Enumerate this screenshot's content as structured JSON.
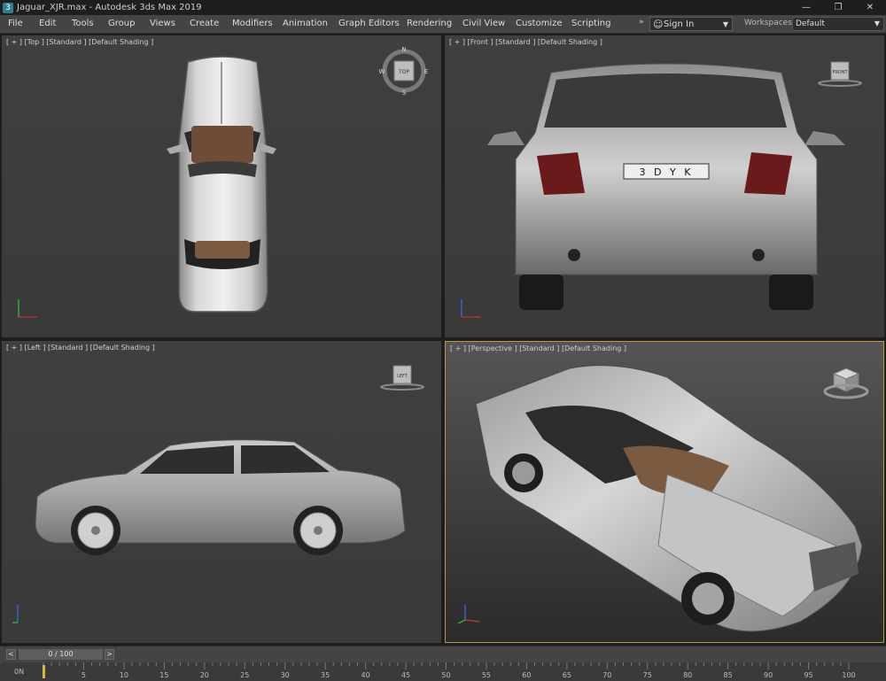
{
  "titlebar": {
    "app_icon": "3ds-max-icon",
    "title": "Jaguar_XJR.max - Autodesk 3ds Max 2019",
    "minimize": "—",
    "restore": "❐",
    "close": "✕"
  },
  "menu": {
    "items": [
      {
        "label": "File"
      },
      {
        "label": "Edit"
      },
      {
        "label": "Tools"
      },
      {
        "label": "Group"
      },
      {
        "label": "Views"
      },
      {
        "label": "Create"
      },
      {
        "label": "Modifiers"
      },
      {
        "label": "Animation"
      },
      {
        "label": "Graph Editors"
      },
      {
        "label": "Rendering"
      },
      {
        "label": "Civil View"
      },
      {
        "label": "Customize"
      },
      {
        "label": "Scripting"
      }
    ],
    "overflow": "»",
    "signin_label": "Sign In",
    "workspaces_label": "Workspaces:",
    "workspaces_value": "Default"
  },
  "viewports": {
    "top": {
      "label": "[ + ] [Top ] [Standard ] [Default Shading ]",
      "cube_label": "TOP",
      "compass": {
        "n": "N",
        "s": "S",
        "e": "E",
        "w": "W"
      }
    },
    "front": {
      "label": "[ + ] [Front ] [Standard ] [Default Shading ]",
      "cube_label": "FRONT",
      "plate": "3 D Y K"
    },
    "left": {
      "label": "[ + ] [Left ] [Standard ] [Default Shading ]",
      "cube_label": "LEFT"
    },
    "perspective": {
      "label": "[ + ] [Perspective ] [Standard ] [Default Shading ]",
      "active": true
    }
  },
  "timeline": {
    "frame_value": "0 / 100",
    "prev": "<",
    "next": ">",
    "corner": "0N",
    "ticks": [
      "0",
      "5",
      "10",
      "15",
      "20",
      "25",
      "30",
      "35",
      "40",
      "45",
      "50",
      "55",
      "60",
      "65",
      "70",
      "75",
      "80",
      "85",
      "90",
      "95",
      "100"
    ]
  },
  "colors": {
    "viewport_bg": "#3d3d3d",
    "active_border": "#b79b4a",
    "car_body": "#b5b5b5",
    "interior": "#7a5a40",
    "axis_x": "#c0392b",
    "axis_y": "#2ecc40",
    "axis_z": "#3a6fd8"
  }
}
